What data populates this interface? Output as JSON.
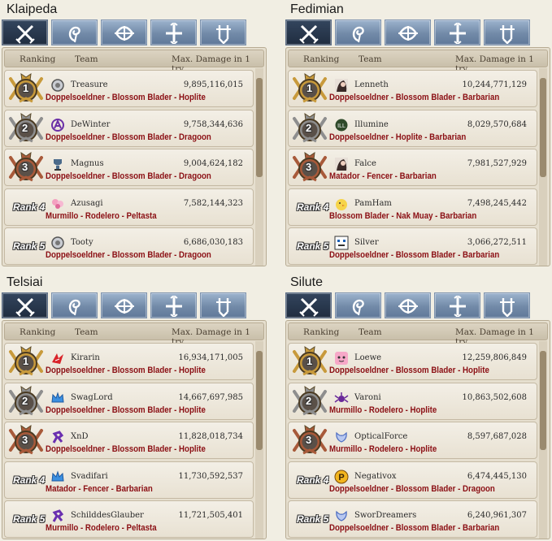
{
  "headers": {
    "ranking": "Ranking",
    "team": "Team",
    "damage": "Max. Damage in 1 try"
  },
  "tabs": [
    {
      "name": "swordsman-class-tab",
      "icon": "crossed-swords-icon",
      "active": true
    },
    {
      "name": "wizard-class-tab",
      "icon": "spiral-icon",
      "active": false
    },
    {
      "name": "archer-class-tab",
      "icon": "bow-icon",
      "active": false
    },
    {
      "name": "cleric-class-tab",
      "icon": "cross-icon",
      "active": false
    },
    {
      "name": "scout-class-tab",
      "icon": "dagger-icon",
      "active": false
    }
  ],
  "medal_colors": {
    "gold": "#c89a3c",
    "silver": "#8e8e8e",
    "bronze": "#a85a3a"
  },
  "team_color": "#8b0f14",
  "panels": [
    {
      "server": "Klaipeda",
      "rows": [
        {
          "rank": "1",
          "name": "Treasure",
          "damage": "9,895,116,015",
          "team": "Doppelsoeldner - Blossom Blader - Hoplite",
          "icon": "shield-icon"
        },
        {
          "rank": "2",
          "name": "DeWinter",
          "damage": "9,758,344,636",
          "team": "Doppelsoeldner - Blossom Blader - Dragoon",
          "icon": "purple-emblem-icon"
        },
        {
          "rank": "3",
          "name": "Magnus",
          "damage": "9,004,624,182",
          "team": "Doppelsoeldner - Blossom Blader - Dragoon",
          "icon": "trophy-icon"
        },
        {
          "rank": "Rank 4",
          "name": "Azusagi",
          "damage": "7,582,144,323",
          "team": "Murmillo - Rodelero - Peltasta",
          "icon": "pink-flower-icon"
        },
        {
          "rank": "Rank 5",
          "name": "Tooty",
          "damage": "6,686,030,183",
          "team": "Doppelsoeldner - Blossom Blader - Dragoon",
          "icon": "shield-icon"
        }
      ]
    },
    {
      "server": "Fedimian",
      "rows": [
        {
          "rank": "1",
          "name": "Lenneth",
          "damage": "10,244,771,129",
          "team": "Doppelsoeldner - Blossom Blader - Barbarian",
          "icon": "portrait-icon"
        },
        {
          "rank": "2",
          "name": "Illumine",
          "damage": "8,029,570,684",
          "team": "Doppelsoeldner - Hoplite - Barbarian",
          "icon": "green-emblem-icon"
        },
        {
          "rank": "3",
          "name": "Falce",
          "damage": "7,981,527,929",
          "team": "Matador - Fencer - Barbarian",
          "icon": "portrait-icon"
        },
        {
          "rank": "Rank 4",
          "name": "PamHam",
          "damage": "7,498,245,442",
          "team": "Blossom Blader - Nak Muay - Barbarian",
          "icon": "chick-icon"
        },
        {
          "rank": "Rank 5",
          "name": "Silver",
          "damage": "3,066,272,511",
          "team": "Doppelsoeldner - Blossom Blader - Barbarian",
          "icon": "pixel-face-icon"
        }
      ]
    },
    {
      "server": "Telsiai",
      "rows": [
        {
          "rank": "1",
          "name": "Kirarin",
          "damage": "16,934,171,005",
          "team": "Doppelsoeldner - Blossom Blader - Hoplite",
          "icon": "red-bird-icon"
        },
        {
          "rank": "2",
          "name": "SwagLord",
          "damage": "14,667,697,985",
          "team": "Doppelsoeldner - Blossom Blader - Hoplite",
          "icon": "blue-crown-icon"
        },
        {
          "rank": "3",
          "name": "XnD",
          "damage": "11,828,018,734",
          "team": "Doppelsoeldner - Blossom Blader - Hoplite",
          "icon": "purple-dragon-icon"
        },
        {
          "rank": "Rank 4",
          "name": "Svadifari",
          "damage": "11,730,592,537",
          "team": "Matador - Fencer - Barbarian",
          "icon": "blue-crown-icon"
        },
        {
          "rank": "Rank 5",
          "name": "SchilddesGlauber",
          "damage": "11,721,505,401",
          "team": "Murmillo - Rodelero - Peltasta",
          "icon": "purple-dragon-icon"
        }
      ]
    },
    {
      "server": "Silute",
      "rows": [
        {
          "rank": "1",
          "name": "Loewe",
          "damage": "12,259,806,849",
          "team": "Doppelsoeldner - Blossom Blader - Hoplite",
          "icon": "pink-face-icon"
        },
        {
          "rank": "2",
          "name": "Varoni",
          "damage": "10,863,502,608",
          "team": "Murmillo - Rodelero - Hoplite",
          "icon": "purple-spider-icon"
        },
        {
          "rank": "3",
          "name": "OpticalForce",
          "damage": "8,597,687,028",
          "team": "Murmillo - Rodelero - Hoplite",
          "icon": "blue-wing-icon"
        },
        {
          "rank": "Rank 4",
          "name": "Negativox",
          "damage": "6,474,445,130",
          "team": "Doppelsoeldner - Blossom Blader - Dragoon",
          "icon": "p-coin-icon"
        },
        {
          "rank": "Rank 5",
          "name": "SworDreamers",
          "damage": "6,240,961,307",
          "team": "Doppelsoeldner - Blossom Blader - Barbarian",
          "icon": "blue-wing-icon"
        }
      ]
    }
  ]
}
